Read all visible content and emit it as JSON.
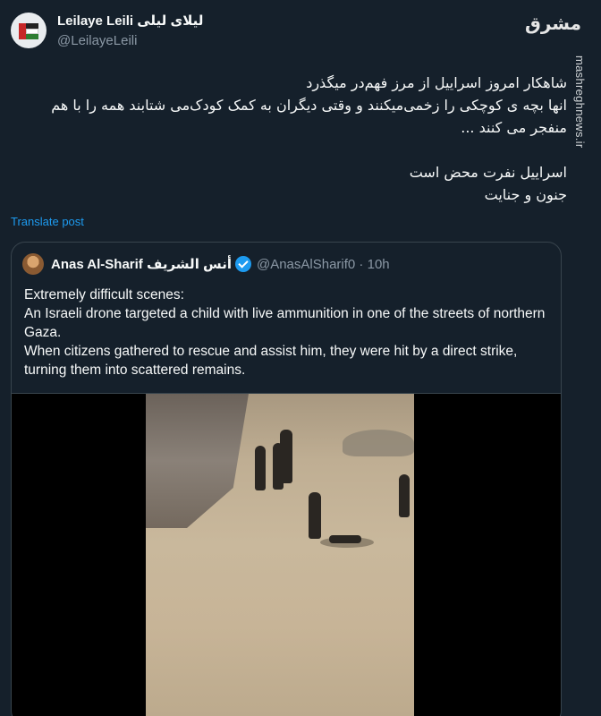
{
  "watermark": {
    "logo_text": "مشرق",
    "url": "mashreghnews.ir"
  },
  "post": {
    "display_name": "Leilaye Leili لیلای لیلی",
    "handle": "@LeilayeLeili",
    "text": "شاهکار امروز اسراییل از مرز فهم‌در میگذرد\nانها بچه ی کوچکی را زخمی‌میکنند و وقتی دیگران به کمک کودک‌می شتابند همه را با هم منفجر می کنند ...\n\nاسراییل نفرت محض است\nجنون و جنایت",
    "translate_label": "Translate post"
  },
  "quoted": {
    "display_name": "Anas Al-Sharif أنس الشريف",
    "handle_time": "@AnasAlSharif0 · 10h",
    "text": "Extremely difficult scenes:\nAn Israeli drone targeted a child with live ammunition in one of the streets of northern Gaza.\nWhen citizens gathered to rescue and assist him, they were hit by a direct strike, turning them into scattered remains."
  }
}
